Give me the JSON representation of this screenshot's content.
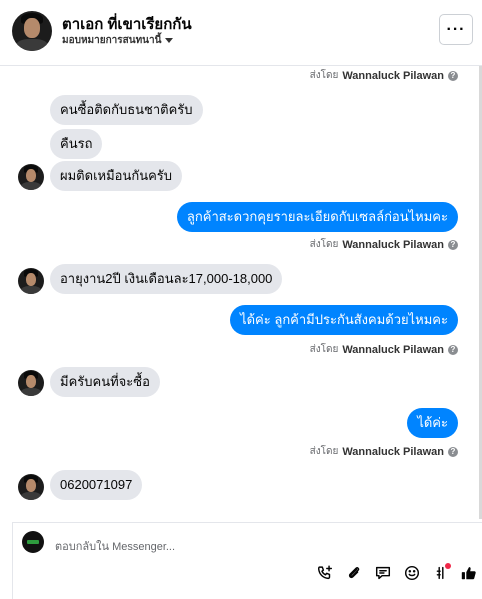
{
  "header": {
    "title": "ตาเอก ที่เขาเรียกกัน",
    "assign_label": "มอบหมายการสนทนานี้",
    "more_label": "···"
  },
  "messages": [
    {
      "type": "sender",
      "prefix": "ส่งโดย",
      "name": "Wannaluck Pilawan",
      "info": "?"
    },
    {
      "type": "in",
      "text": "คนซื้อติดกับธนชาติครับ"
    },
    {
      "type": "in",
      "text": "คืนรถ"
    },
    {
      "type": "in",
      "text": "ผมติดเหมือนกันครับ"
    },
    {
      "type": "out",
      "text": "ลูกค้าสะดวกคุยรายละเอียดกับเซลล์ก่อนไหมคะ"
    },
    {
      "type": "sender",
      "prefix": "ส่งโดย",
      "name": "Wannaluck Pilawan",
      "info": "?"
    },
    {
      "type": "in",
      "text": "อายุงาน2ปี เงินเดือนละ17,000-18,000"
    },
    {
      "type": "out",
      "text": "ได้ค่ะ ลูกค้ามีประกันสังคมด้วยไหมคะ"
    },
    {
      "type": "sender",
      "prefix": "ส่งโดย",
      "name": "Wannaluck Pilawan",
      "info": "?"
    },
    {
      "type": "in",
      "text": "มีครับคนที่จะซื้อ"
    },
    {
      "type": "out",
      "text": "ได้ค่ะ"
    },
    {
      "type": "sender",
      "prefix": "ส่งโดย",
      "name": "Wannaluck Pilawan",
      "info": "?"
    },
    {
      "type": "in",
      "text": "0620071097"
    }
  ],
  "composer": {
    "placeholder": "ตอบกลับใน Messenger...",
    "tools": [
      "call-add-icon",
      "attachment-icon",
      "saved-reply-icon",
      "emoji-icon",
      "hashtag-icon",
      "like-icon"
    ]
  },
  "colors": {
    "outgoing_bubble": "#0084ff",
    "incoming_bubble": "#e4e6eb",
    "notification_dot": "#f02849"
  }
}
